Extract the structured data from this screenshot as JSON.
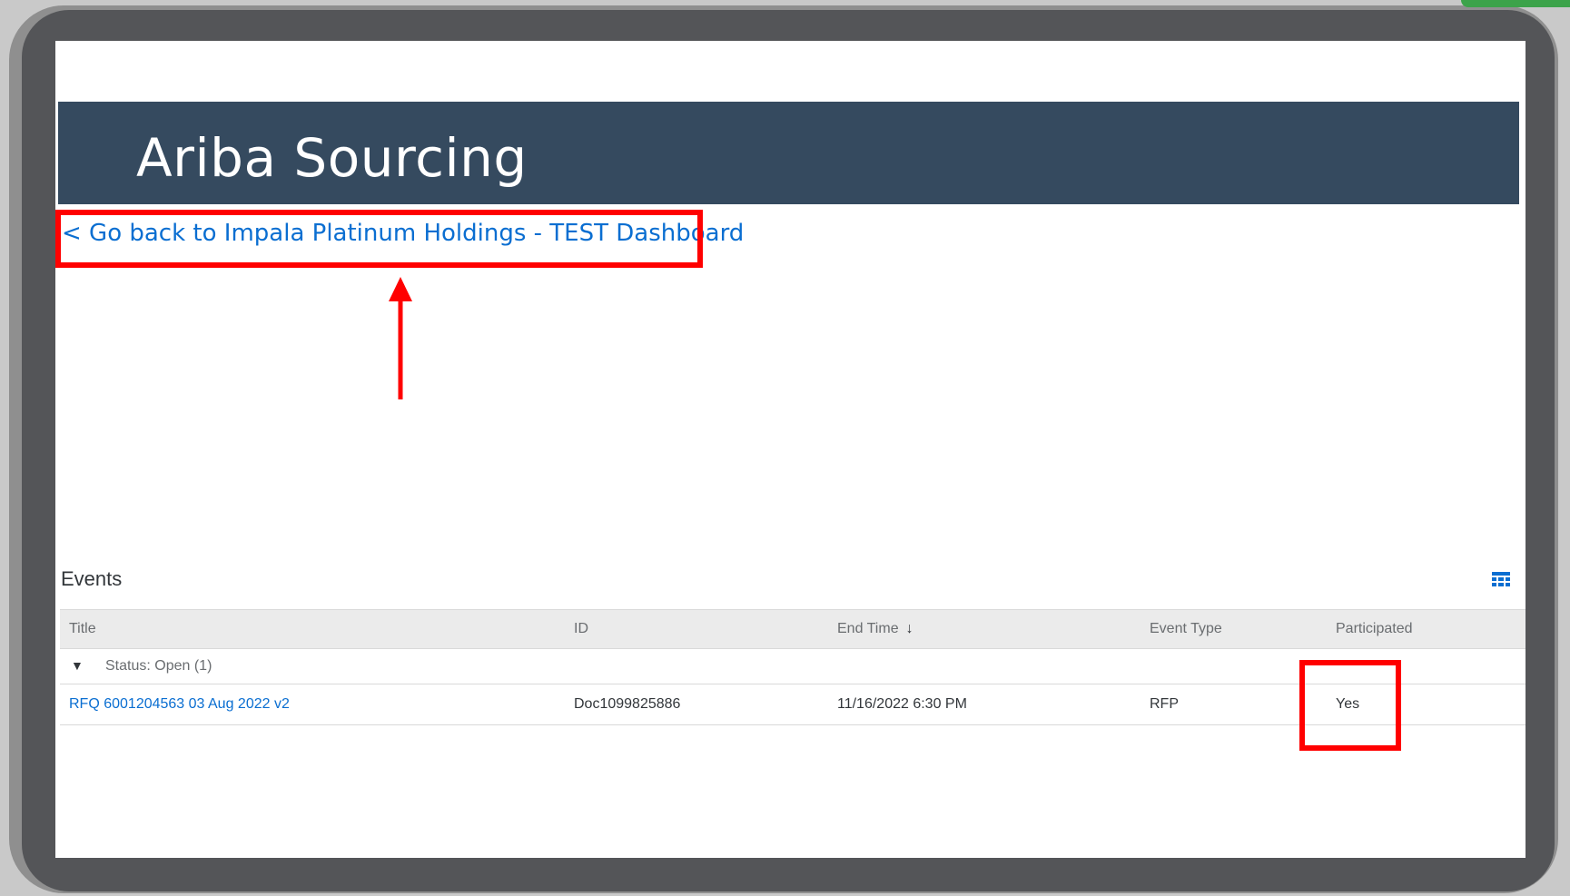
{
  "header": {
    "app_title": "Ariba Sourcing"
  },
  "navigation": {
    "back_link": "< Go back to Impala Platinum Holdings - TEST Dashboard"
  },
  "events": {
    "section_title": "Events",
    "table_settings_icon": "grid-icon",
    "columns": [
      "Title",
      "ID",
      "End Time",
      "Event Type",
      "Participated"
    ],
    "sorted_column_icon": "arrow-down-icon",
    "group": {
      "toggle_icon": "triangle-down-icon",
      "label": "Status: Open  (1)"
    },
    "rows": [
      {
        "title": "RFQ 6001204563 03 Aug 2022 v2",
        "id": "Doc1099825886",
        "end_time": "11/16/2022 6:30 PM",
        "event_type": "RFP",
        "participated": "Yes"
      }
    ]
  },
  "colors": {
    "header_bg": "#354a5f",
    "link": "#0a6ed1",
    "annotation": "#ff0000"
  }
}
